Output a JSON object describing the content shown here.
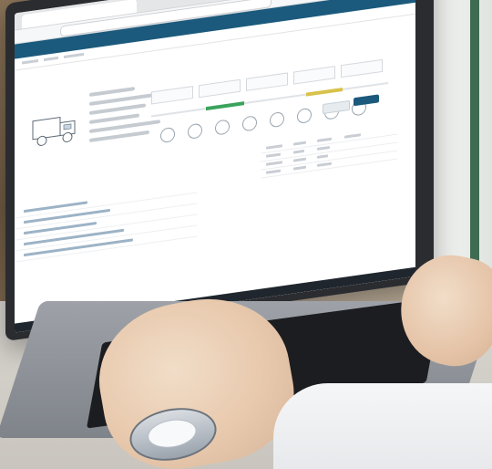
{
  "scene": {
    "colors": {
      "header": "#1b5a7c",
      "accent_green": "#3aa35b",
      "accent_yellow": "#d8c24a",
      "accent_blue": "#2c7fb8"
    },
    "icons": [
      "truck-illustration",
      "timeline-step-icon",
      "wrist-watch"
    ]
  }
}
